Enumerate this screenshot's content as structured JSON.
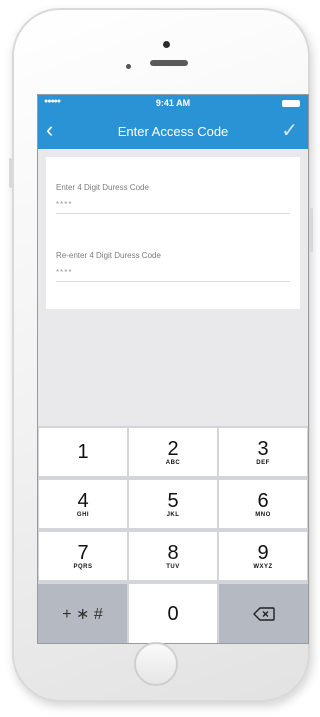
{
  "status_bar": {
    "signal": "●●●●●",
    "time": "9:41 AM"
  },
  "nav": {
    "back_icon": "chevron-left-icon",
    "title": "Enter Access Code",
    "confirm_icon": "checkmark-icon"
  },
  "form": {
    "fields": [
      {
        "label": "Enter 4 Digit Duress Code",
        "value": "****"
      },
      {
        "label": "Re-enter 4 Digit Duress Code",
        "value": "****"
      }
    ]
  },
  "keypad": {
    "keys": [
      {
        "digit": "1",
        "letters": ""
      },
      {
        "digit": "2",
        "letters": "ABC"
      },
      {
        "digit": "3",
        "letters": "DEF"
      },
      {
        "digit": "4",
        "letters": "GHI"
      },
      {
        "digit": "5",
        "letters": "JKL"
      },
      {
        "digit": "6",
        "letters": "MNO"
      },
      {
        "digit": "7",
        "letters": "PQRS"
      },
      {
        "digit": "8",
        "letters": "TUV"
      },
      {
        "digit": "9",
        "letters": "WXYZ"
      },
      {
        "digit": "0",
        "letters": ""
      }
    ],
    "symbols_label": "+ ∗ #",
    "delete_icon": "backspace-icon"
  }
}
